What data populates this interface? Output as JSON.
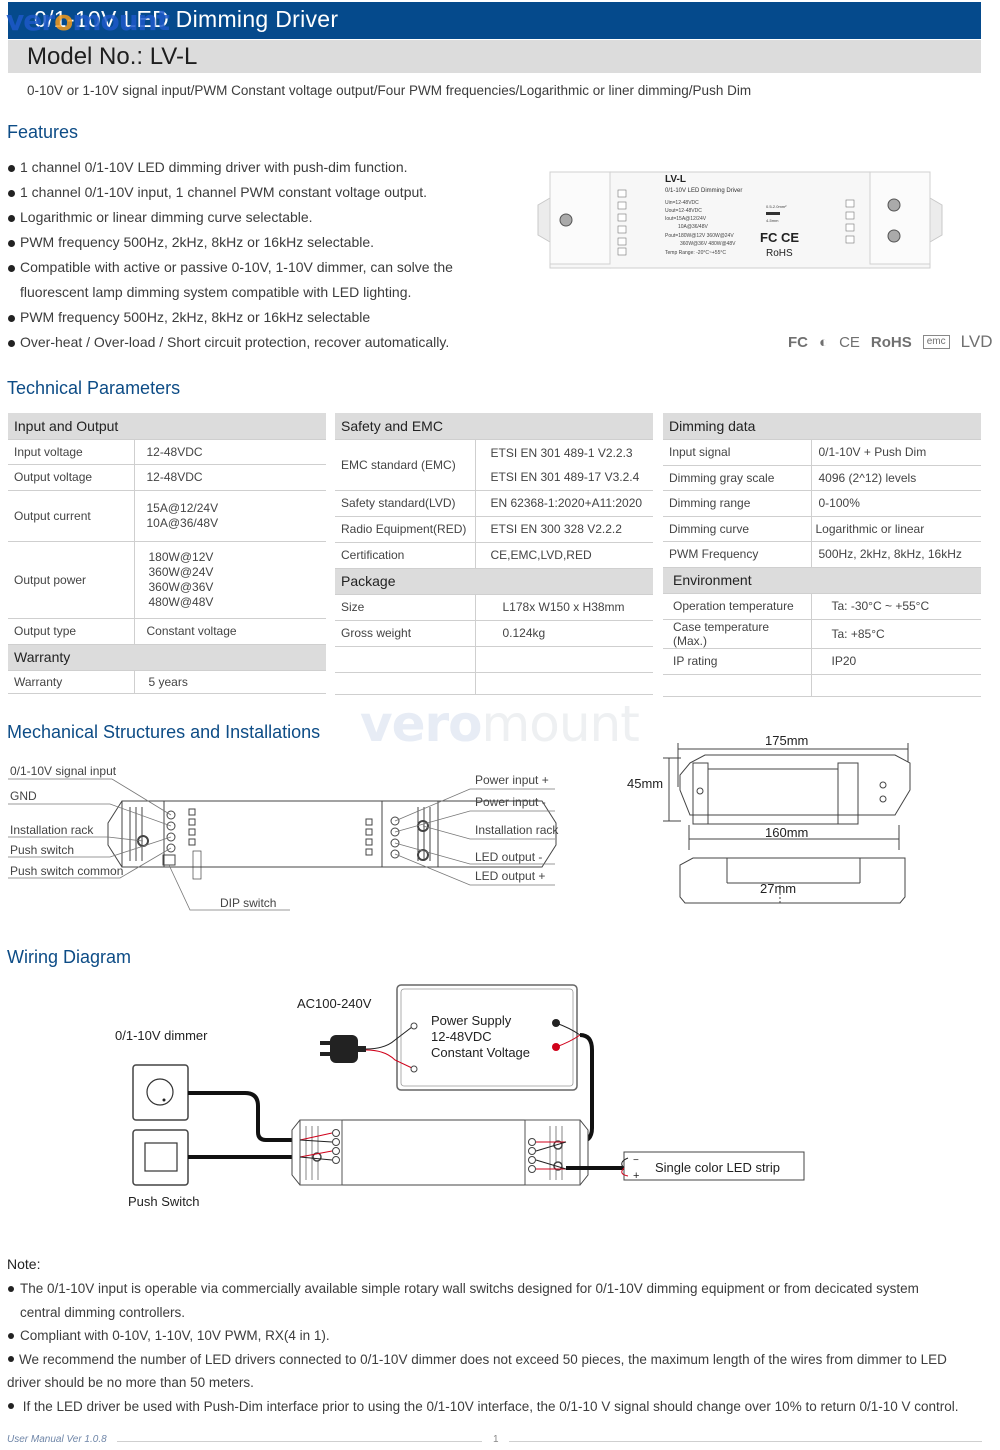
{
  "header": {
    "title": "0/1-10V LED Dimming Driver",
    "watermark": "veromount",
    "model": "Model No.: LV-L",
    "subtitle": "0-10V or 1-10V signal input/PWM Constant voltage output/Four PWM frequencies/Logarithmic or liner dimming/Push Dim",
    "colors": {
      "title_bar": "#054a8c",
      "model_bar": "#dcdcdc",
      "heading": "#0d4c86"
    }
  },
  "features": {
    "heading": "Features",
    "items": [
      "1 channel 0/1-10V LED dimming driver with push-dim function.",
      "1 channel 0/1-10V input, 1 channel PWM constant voltage output.",
      "Logarithmic or linear dimming curve selectable.",
      "PWM frequency 500Hz, 2kHz, 8kHz or 16kHz selectable.",
      "Compatible with active or passive 0-10V, 1-10V dimmer, can solve the fluorescent lamp dimming system compatible with LED lighting.",
      "PWM frequency 500Hz, 2kHz, 8kHz or 16kHz selectable",
      "Over-heat / Over-load / Short circuit protection, recover automatically."
    ]
  },
  "product_label": {
    "model": "LV-L",
    "name": "0/1-10V LED Dimming Driver",
    "uin": "Uin=12-48VDC",
    "uout": "Uout=12-48VDC",
    "iout1": "Iout=15A@12/24V",
    "iout2": "10A@36/48V",
    "pout1": "Pout=180W@12V  360W@24V",
    "pout2": "360W@36V  480W@48V",
    "temp": "Temp Range: -20°C~+55°C",
    "wire": "0.5-2.0mm²",
    "strip": "4-5mm",
    "marks": [
      "FC",
      "CE",
      "RoHS"
    ]
  },
  "certifications": [
    "FC",
    "C",
    "CE",
    "RoHS",
    "emc",
    "LVD"
  ],
  "tech": {
    "heading": "Technical Parameters",
    "input_output": {
      "title": "Input and Output",
      "rows": [
        {
          "k": "Input voltage",
          "v": [
            "12-48VDC"
          ]
        },
        {
          "k": "Output voltage",
          "v": [
            "12-48VDC"
          ]
        },
        {
          "k": "Output current",
          "v": [
            "15A@12/24V",
            "10A@36/48V"
          ]
        },
        {
          "k": "Output power",
          "v": [
            "180W@12V",
            "360W@24V",
            "360W@36V",
            "480W@48V"
          ]
        },
        {
          "k": "Output type",
          "v": [
            "Constant voltage"
          ]
        }
      ]
    },
    "warranty": {
      "title": "Warranty",
      "rows": [
        {
          "k": "Warranty",
          "v": [
            "5 years"
          ]
        }
      ]
    },
    "safety": {
      "title": "Safety and EMC",
      "rows": [
        {
          "k": "EMC standard (EMC)",
          "v": [
            "ETSI EN 301 489-1 V2.2.3",
            "ETSI EN 301 489-17 V3.2.4"
          ]
        },
        {
          "k": "Safety standard(LVD)",
          "v": [
            "EN 62368-1:2020+A11:2020"
          ]
        },
        {
          "k": "Radio Equipment(RED)",
          "v": [
            "ETSI EN 300 328 V2.2.2"
          ]
        },
        {
          "k": "Certification",
          "v": [
            "CE,EMC,LVD,RED"
          ]
        }
      ]
    },
    "package": {
      "title": "Package",
      "rows": [
        {
          "k": "Size",
          "v": [
            "L178x W150 x H38mm"
          ]
        },
        {
          "k": "Gross weight",
          "v": [
            "0.124kg"
          ]
        }
      ]
    },
    "dimming": {
      "title": "Dimming data",
      "rows": [
        {
          "k": "Input signal",
          "v": [
            "0/1-10V + Push Dim"
          ]
        },
        {
          "k": "Dimming gray scale",
          "v": [
            "4096 (2^12) levels"
          ]
        },
        {
          "k": "Dimming range",
          "v": [
            "0-100%"
          ]
        },
        {
          "k": "Dimming curve",
          "v": [
            "Logarithmic or linear"
          ]
        },
        {
          "k": "PWM Frequency",
          "v": [
            "500Hz, 2kHz, 8kHz, 16kHz"
          ]
        }
      ]
    },
    "environment": {
      "title": "Environment",
      "rows": [
        {
          "k": "Operation temperature",
          "v": [
            "Ta: -30°C ~ +55°C"
          ]
        },
        {
          "k": "Case temperature (Max.)",
          "v": [
            "Ta: +85°C"
          ]
        },
        {
          "k": "IP rating",
          "v": [
            "IP20"
          ]
        }
      ]
    }
  },
  "mechanical": {
    "heading": "Mechanical Structures and Installations",
    "left_labels": [
      "0/1-10V signal input",
      "GND",
      "Installation rack",
      "Push switch",
      "Push switch common"
    ],
    "right_labels": [
      "Power input +",
      "Power input -",
      "Installation rack",
      "LED output -",
      "LED output +"
    ],
    "bottom_label": "DIP switch",
    "dims": {
      "length": "175mm",
      "height": "45mm",
      "inner": "160mm",
      "depth": "27mm"
    }
  },
  "wiring": {
    "heading": "Wiring Diagram",
    "ac": "AC100-240V",
    "dimmer": "0/1-10V dimmer",
    "push": "Push Switch",
    "psu": [
      "Power Supply",
      "12-48VDC",
      "Constant Voltage"
    ],
    "strip": "Single color LED strip",
    "strip_minus": "−",
    "strip_plus": "+",
    "wire_color": "#d0021b"
  },
  "notes": {
    "heading": "Note:",
    "items": [
      "The 0/1-10V input is operable via commercially available simple rotary wall switchs designed for 0/1-10V dimming equipment or from decicated system",
      "central dimming controllers.",
      "Compliant with 0-10V, 1-10V, 10V PWM, RX(4 in 1).",
      "We recommend the number of LED drivers connected to 0/1-10V dimmer does not exceed 50 pieces, the maximum length of the wires from dimmer to LED",
      "driver should be no more than 50 meters.",
      "If the LED driver be used with Push-Dim interface prior to using the 0/1-10V interface, the 0/1-10 V signal should change over 10% to return 0/1-10 V control."
    ]
  },
  "footer": {
    "version": "User Manual Ver 1.0.8",
    "page": "1"
  }
}
